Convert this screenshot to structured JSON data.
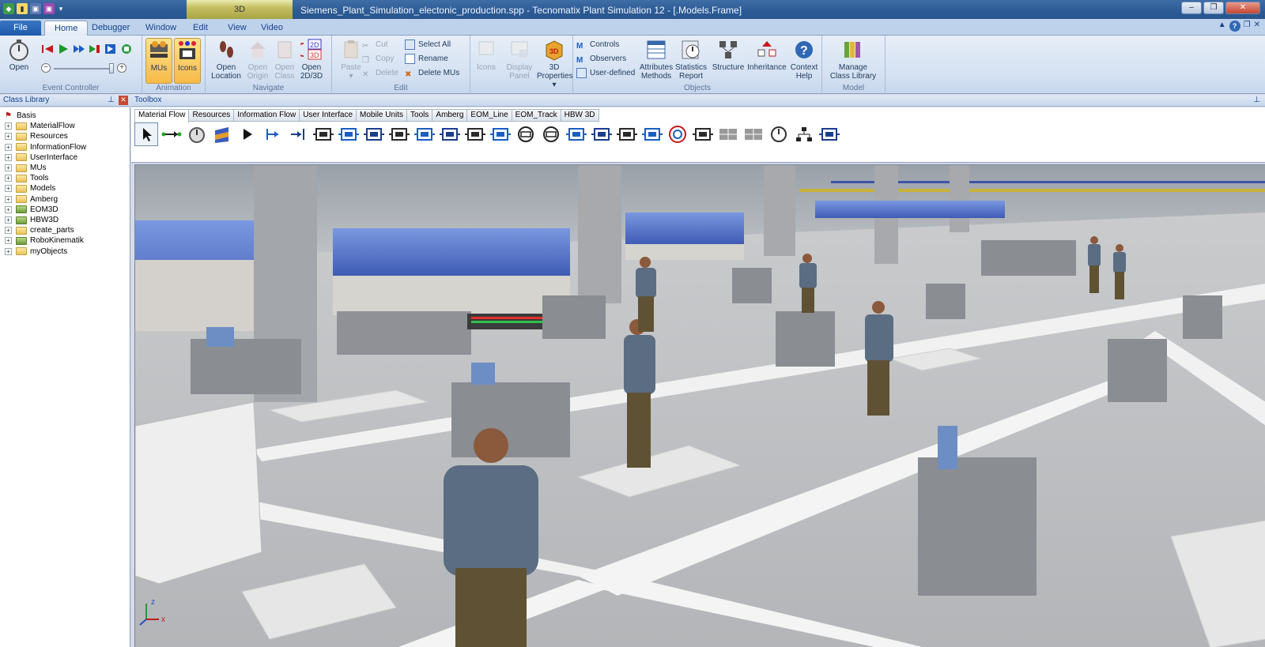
{
  "title_bar": {
    "context_tab": "3D",
    "title": "Siemens_Plant_Simulation_electonic_production.spp - Tecnomatix Plant Simulation 12 - [.Models.Frame]"
  },
  "ribbon_tabs": [
    "File",
    "Home",
    "Debugger",
    "Window",
    "Edit",
    "View",
    "Video"
  ],
  "active_tab": "Home",
  "groups": {
    "event_controller": {
      "label": "Event Controller",
      "open": "Open"
    },
    "animation": {
      "label": "Animation",
      "mus": "MUs",
      "icons": "Icons"
    },
    "navigate": {
      "label": "Navigate",
      "open_location": [
        "Open",
        "Location"
      ],
      "open_origin": [
        "Open",
        "Origin"
      ],
      "open_class": [
        "Open",
        "Class"
      ],
      "open_2d3d": [
        "Open",
        "2D/3D"
      ]
    },
    "edit": {
      "label": "Edit",
      "paste": "Paste",
      "cut": "Cut",
      "copy": "Copy",
      "delete": "Delete",
      "select_all": "Select All",
      "rename": "Rename",
      "delete_mus": "Delete MUs"
    },
    "objects_left": {
      "icons": "Icons",
      "display_panel": [
        "Display",
        "Panel"
      ],
      "properties_3d": [
        "3D",
        "Properties"
      ]
    },
    "objects": {
      "label": "Objects",
      "controls": "Controls",
      "observers": "Observers",
      "user_defined": "User-defined",
      "attributes_methods": [
        "Attributes",
        "Methods"
      ],
      "statistics_report": [
        "Statistics",
        "Report"
      ],
      "structure": "Structure",
      "inheritance": "Inheritance",
      "context_help": [
        "Context",
        "Help"
      ]
    },
    "model": {
      "label": "Model",
      "manage_class_library": [
        "Manage",
        "Class Library"
      ]
    }
  },
  "class_library": {
    "header": "Class Library",
    "items": [
      {
        "label": "Basis",
        "type": "root"
      },
      {
        "label": "MaterialFlow",
        "type": "folder"
      },
      {
        "label": "Resources",
        "type": "folder"
      },
      {
        "label": "InformationFlow",
        "type": "folder"
      },
      {
        "label": "UserInterface",
        "type": "folder"
      },
      {
        "label": "MUs",
        "type": "folder"
      },
      {
        "label": "Tools",
        "type": "folder"
      },
      {
        "label": "Models",
        "type": "folder"
      },
      {
        "label": "Amberg",
        "type": "folder"
      },
      {
        "label": "EOM3D",
        "type": "lib"
      },
      {
        "label": "HBW3D",
        "type": "lib"
      },
      {
        "label": "create_parts",
        "type": "folder"
      },
      {
        "label": "RoboKinematik",
        "type": "lib"
      },
      {
        "label": "myObjects",
        "type": "folder"
      }
    ]
  },
  "toolbox": {
    "header": "Toolbox",
    "tabs": [
      "Material Flow",
      "Resources",
      "Information Flow",
      "User Interface",
      "Mobile Units",
      "Tools",
      "Amberg",
      "EOM_Line",
      "EOM_Track",
      "HBW 3D"
    ],
    "active_tab": "Material Flow",
    "tools": [
      "pointer-icon",
      "connector-icon",
      "event-controller-icon",
      "frame-icon",
      "source-icon",
      "interface-icon",
      "drain-icon",
      "single-proc-icon",
      "parallel-proc-icon",
      "assembly-icon",
      "dismantle-icon",
      "shift-calendar-icon",
      "store-icon",
      "line-icon",
      "angular-converter-icon",
      "turntable-icon",
      "turnplate-icon",
      "track-icon",
      "tow-track-icon",
      "transfer-icon",
      "cycle-icon",
      "sorter-icon",
      "flow-control-icon",
      "buffer-icon",
      "placement-buffer-icon",
      "generator-icon",
      "hierarchy-icon",
      "station-icon"
    ]
  },
  "viewport": {
    "axes": {
      "z": "z",
      "x": "x"
    },
    "colors": {
      "floor": "#b9bcc0",
      "walkway": "#f2f2f2",
      "machine": "#5a7ad0",
      "column": "#a7a9ad"
    }
  }
}
